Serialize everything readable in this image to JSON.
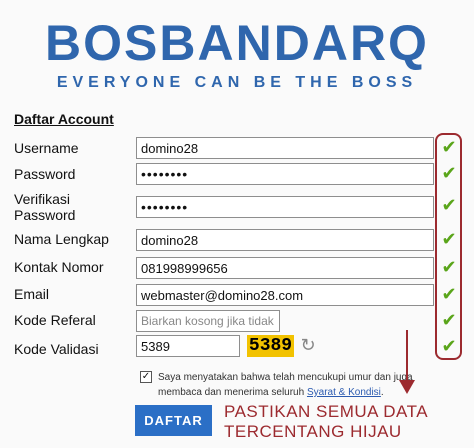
{
  "brand": {
    "logo": "BOSBANDARQ",
    "tagline": "EVERYONE CAN BE THE BOSS"
  },
  "form": {
    "title": "Daftar Account",
    "fields": {
      "username": {
        "label": "Username",
        "value": "domino28"
      },
      "password": {
        "label": "Password",
        "value": "••••••••"
      },
      "verify": {
        "label": "Verifikasi Password",
        "value": "••••••••"
      },
      "fullname": {
        "label": "Nama Lengkap",
        "value": "domino28"
      },
      "phone": {
        "label": "Kontak Nomor",
        "value": "081998999656"
      },
      "email": {
        "label": "Email",
        "value": "webmaster@domino28.com"
      },
      "referral": {
        "label": "Kode Referal",
        "value": "",
        "placeholder": "Biarkan kosong jika tidak"
      },
      "validation": {
        "label": "Kode Validasi",
        "value": "5389"
      }
    },
    "captcha": "5389",
    "agree": {
      "text": "Saya menyatakan bahwa telah mencukupi umur dan juga membaca dan menerima seluruh ",
      "link": "Syarat & Kondisi",
      "tail": "."
    },
    "submit_label": "DAFTAR"
  },
  "annotation": {
    "line1": "PASTIKAN SEMUA DATA",
    "line2": "TERCENTANG HIJAU"
  },
  "icons": {
    "check": "checkmark-icon",
    "refresh": "refresh-icon"
  },
  "colors": {
    "brand": "#2f66ad",
    "annotation": "#9c2a2f",
    "check": "#5aa51a",
    "captcha_bg": "#f2c200",
    "button": "#2b6fc6"
  }
}
